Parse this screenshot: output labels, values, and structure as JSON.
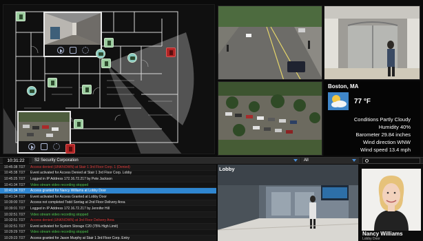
{
  "toolbar": {
    "time": "10:31:22",
    "company": "S2 Security Corporation",
    "filter": "All",
    "search_placeholder": ""
  },
  "weather": {
    "city": "Boston, MA",
    "temperature": "77 °F",
    "conditions": "Conditions Partly Cloudy",
    "humidity": "Humidity 40%",
    "barometer": "Barometer 29.84 inches",
    "wind_direction": "Wind direction WNW",
    "wind_speed": "Wind speed 13.4 mph"
  },
  "lobby": {
    "label": "Lobby"
  },
  "person": {
    "name": "Nancy Williams",
    "door": "Lobby Door"
  },
  "events": [
    {
      "time": "10:45:38 7/27",
      "text": "Access denied (UNKNOWN) at Stair 1 3rd Floor Corp. 1 (Denied)",
      "color": "#e03a3a"
    },
    {
      "time": "10:45:38 7/27",
      "text": "Event activated for Access Denied at Stair 1 3rd Floor Corp. Lobby",
      "color": "#e4e4e4"
    },
    {
      "time": "10:45:25 7/27",
      "text": "Logged in IP Address 172.16.72.217 by Pete Jackson",
      "color": "#e4e4e4"
    },
    {
      "time": "10:41:34 7/27",
      "text": "Video stream video recording stopped",
      "color": "#4fcb4f"
    },
    {
      "time": "10:41:34 7/27",
      "text": "Access granted for Nancy Williams at Lobby Door",
      "color": "#ffffff",
      "selected": true
    },
    {
      "time": "10:41:34 7/27",
      "text": "Event activated for Access Granted at Lobby Door",
      "color": "#e4e4e4"
    },
    {
      "time": "10:39:00 7/27",
      "text": "Access not completed Todd Sontag at 2nd Floor Delivery Area",
      "color": "#e4e4e4"
    },
    {
      "time": "10:39:01 7/27",
      "text": "Logged in IP Address 172.16.72.217 by Jennifer Hill",
      "color": "#e4e4e4"
    },
    {
      "time": "10:32:51 7/27",
      "text": "Video stream video recording stopped",
      "color": "#4fcb4f"
    },
    {
      "time": "10:32:51 7/27",
      "text": "Access denied (UNKNOWN) at 3rd Floor Delivery Area",
      "color": "#e03a3a"
    },
    {
      "time": "10:32:51 7/27",
      "text": "Event activated for System Storage C20 (75% High Limit)",
      "color": "#e4e4e4"
    },
    {
      "time": "10:29:29 7/27",
      "text": "Video stream video recording stopped",
      "color": "#4fcb4f"
    },
    {
      "time": "10:29:23 7/27",
      "text": "Access granted for Jason Murphy at Stair 1 3rd Floor Corp. Entry",
      "color": "#f0f0f0"
    }
  ],
  "colors": {
    "selected_row": "#2f86d0",
    "alarm": "#b02424",
    "door_icon": "#9bcc9e",
    "dropdown_accent": "#4a8fd8"
  }
}
